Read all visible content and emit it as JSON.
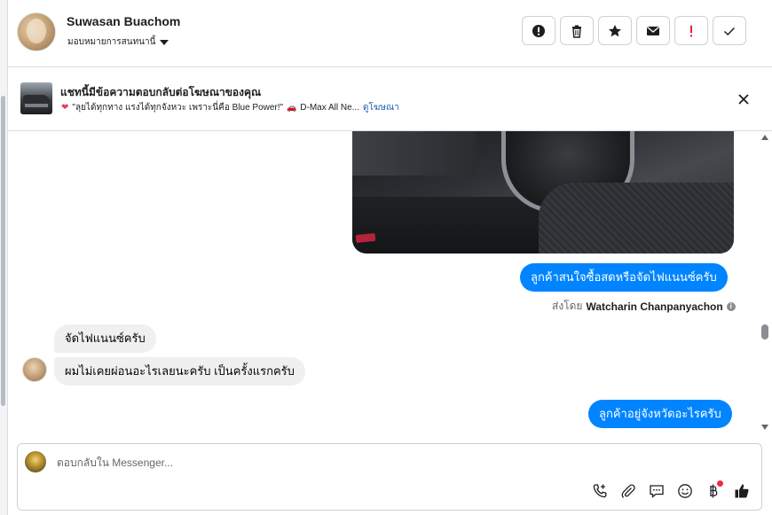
{
  "colors": {
    "accent": "#0084ff",
    "border": "#ccd0d5",
    "danger": "#e4405f",
    "link": "#1a5fb4"
  },
  "header": {
    "name": "Suwasan Buachom",
    "assign_label": "มอบหมายการสนทนานี้",
    "actions": [
      {
        "icon": "alert-circle-icon"
      },
      {
        "icon": "trash-icon"
      },
      {
        "icon": "star-icon"
      },
      {
        "icon": "envelope-icon"
      },
      {
        "icon": "exclamation-icon"
      },
      {
        "icon": "checkmark-icon"
      }
    ]
  },
  "ad_banner": {
    "title": "แชทนี้มีข้อความตอบกลับต่อโฆษณาของคุณ",
    "quote": "\"ลุยได้ทุกทาง แรงได้ทุกจังหวะ เพราะนี่คือ Blue Power!\"",
    "car_text": "D-Max All Ne...",
    "link": "ดูโฆษณา"
  },
  "messages": {
    "out_1": "ลูกค้าสนใจซื้อสดหรือจัดไฟแนนซ์ครับ",
    "sent_by_prefix": "ส่งโดย",
    "sent_by_name": "Watcharin Chanpanyachon",
    "in_1": "จัดไฟแนนซ์ครับ",
    "in_2": "ผมไม่เคยผ่อนอะไรเลยนะครับ เป็นครั้งแรกครับ",
    "out_2": "ลูกค้าอยู่จังหวัดอะไรครับ"
  },
  "composer": {
    "placeholder": "ตอบกลับใน Messenger...",
    "value": "",
    "tools": [
      "phone-add-icon",
      "paperclip-icon",
      "saved-replies-icon",
      "emoji-icon",
      "baht-icon",
      "like-icon"
    ]
  }
}
